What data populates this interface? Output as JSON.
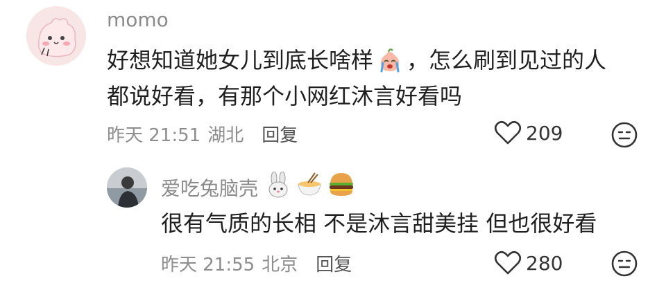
{
  "comments": [
    {
      "username": "momo",
      "text_line1": "好想知道她女儿到底长啥样",
      "text_line1_suffix": "，怎么刷到见过的人",
      "text_line2": "都说好看，有那个小网红沐言好看吗",
      "time": "昨天 21:51",
      "location": "湖北",
      "reply_label": "回复",
      "like_count": "209"
    },
    {
      "username": "爱吃兔脑壳",
      "text": "很有气质的长相 不是沐言甜美挂 但也很好看",
      "time": "昨天 21:55",
      "location": "北京",
      "reply_label": "回复",
      "like_count": "280"
    }
  ],
  "icons": {
    "like": "heart-outline-icon",
    "dislike": "neutral-face-icon",
    "crying_emoji": "crying-peach-emoji",
    "username_emojis": [
      "rabbit-emoji",
      "noodle-bowl-emoji",
      "hamburger-emoji"
    ]
  },
  "colors": {
    "username": "#8a8a8a",
    "text": "#1f1f1f",
    "meta": "#8d8d8d"
  }
}
